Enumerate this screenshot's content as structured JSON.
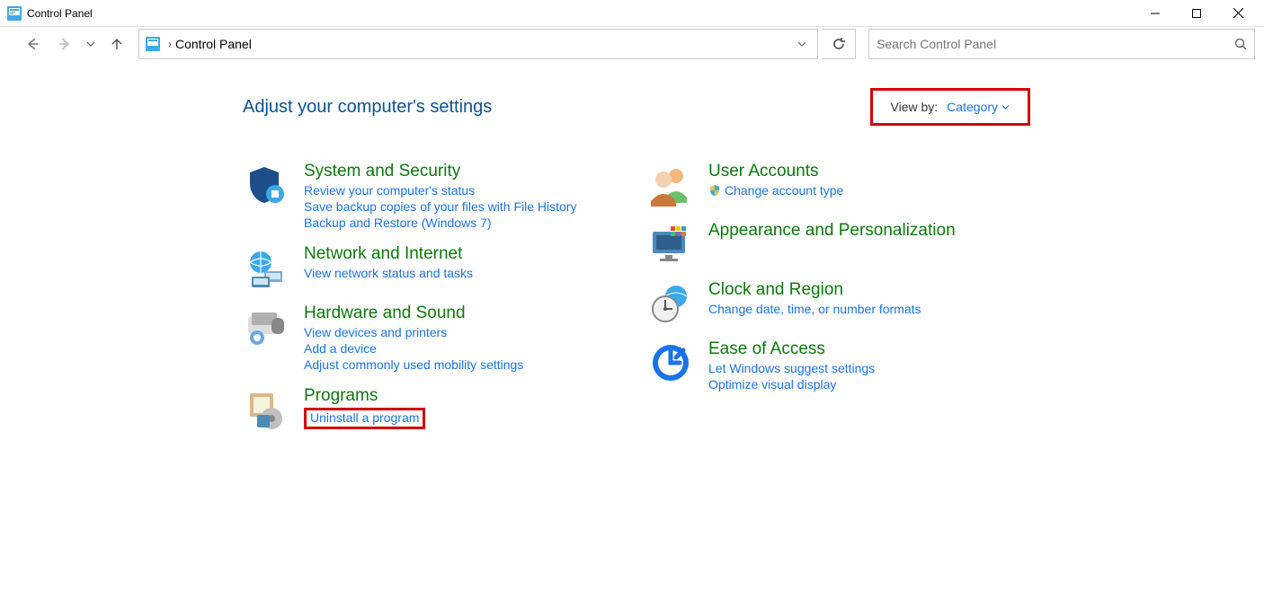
{
  "titlebar": {
    "title": "Control Panel"
  },
  "breadcrumb": {
    "location": "Control Panel"
  },
  "search": {
    "placeholder": "Search Control Panel"
  },
  "header": {
    "title": "Adjust your computer's settings",
    "viewby_label": "View by:",
    "viewby_value": "Category"
  },
  "categories": {
    "system_security": {
      "title": "System and Security",
      "links": [
        "Review your computer's status",
        "Save backup copies of your files with File History",
        "Backup and Restore (Windows 7)"
      ]
    },
    "network_internet": {
      "title": "Network and Internet",
      "links": [
        "View network status and tasks"
      ]
    },
    "hardware_sound": {
      "title": "Hardware and Sound",
      "links": [
        "View devices and printers",
        "Add a device",
        "Adjust commonly used mobility settings"
      ]
    },
    "programs": {
      "title": "Programs",
      "links": [
        "Uninstall a program"
      ]
    },
    "user_accounts": {
      "title": "User Accounts",
      "links": [
        "Change account type"
      ]
    },
    "appearance": {
      "title": "Appearance and Personalization"
    },
    "clock_region": {
      "title": "Clock and Region",
      "links": [
        "Change date, time, or number formats"
      ]
    },
    "ease_access": {
      "title": "Ease of Access",
      "links": [
        "Let Windows suggest settings",
        "Optimize visual display"
      ]
    }
  }
}
